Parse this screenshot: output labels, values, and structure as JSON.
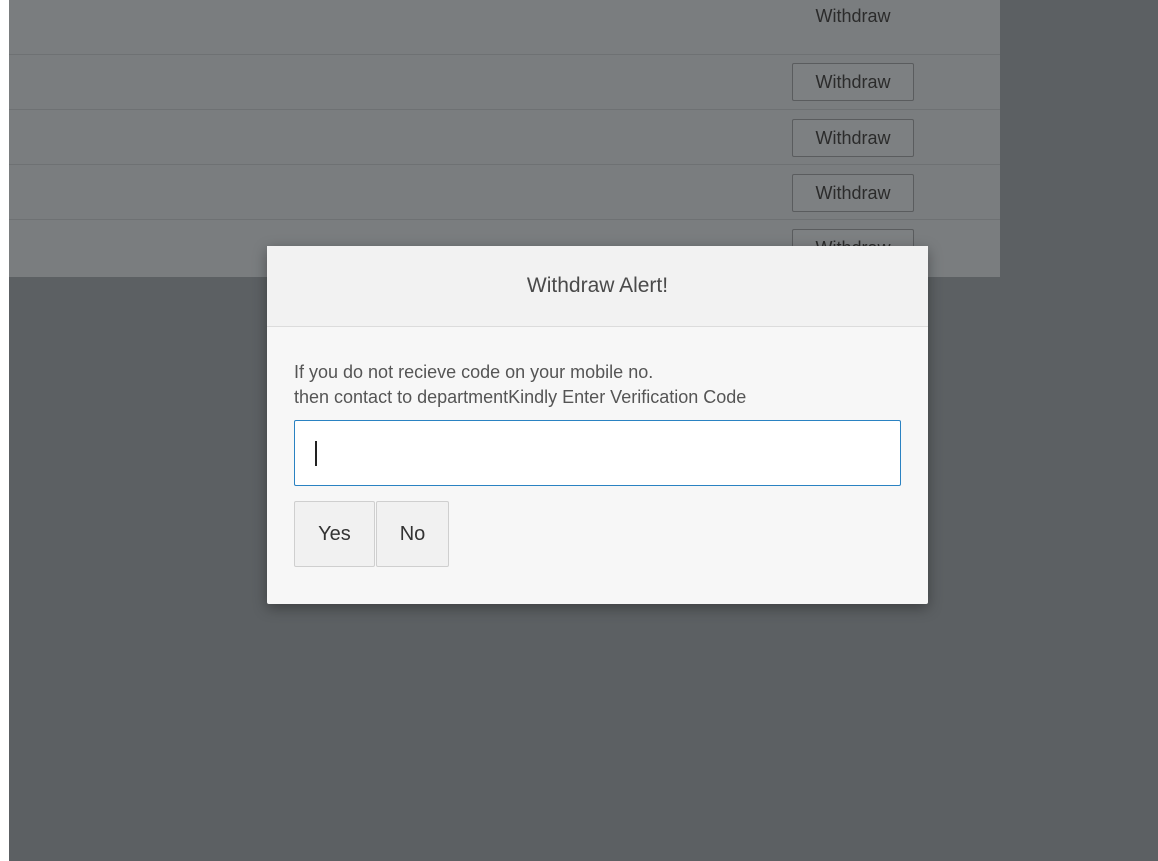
{
  "background": {
    "header_action": "Withdraw",
    "row_buttons": [
      "Withdraw",
      "Withdraw",
      "Withdraw",
      "Withdraw"
    ]
  },
  "modal": {
    "title": "Withdraw Alert!",
    "message_line1": "If you do not recieve code on your mobile no.",
    "message_line2": "then contact to departmentKindly Enter Verification Code",
    "input_value": "",
    "yes_label": "Yes",
    "no_label": "No"
  },
  "colors": {
    "overlay": "#5c6063",
    "input_focus_border": "#2a82c2"
  }
}
